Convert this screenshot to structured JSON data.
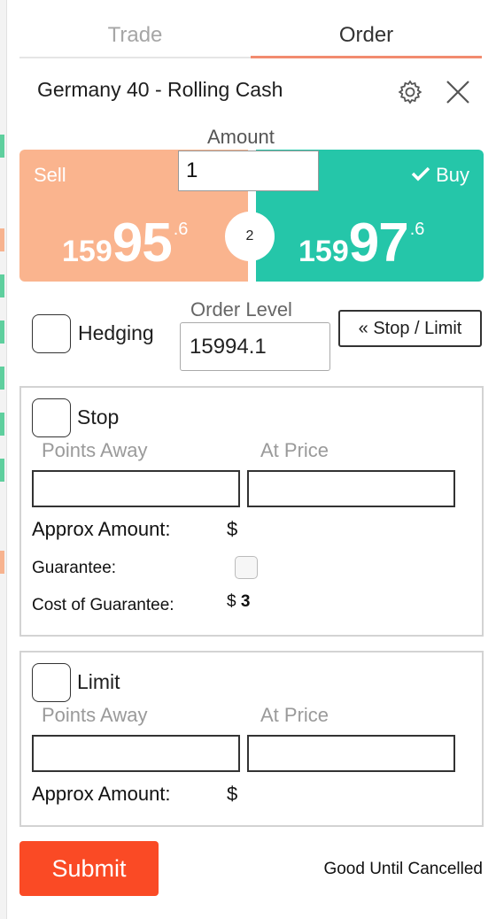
{
  "tabs": [
    {
      "label": "Trade",
      "active": false
    },
    {
      "label": "Order",
      "active": true
    }
  ],
  "instrument_title": "Germany 40 - Rolling Cash",
  "amount": {
    "label": "Amount",
    "value": "1"
  },
  "sell": {
    "label": "Sell",
    "price_prefix": "159",
    "price_main": "95",
    "price_fraction": ".6"
  },
  "buy": {
    "label": "Buy",
    "price_prefix": "159",
    "price_main": "97",
    "price_fraction": ".6"
  },
  "spread": "2",
  "hedging_label": "Hedging",
  "order_level": {
    "label": "Order Level",
    "value": "15994.1"
  },
  "stop_limit_button": "« Stop / Limit",
  "stop_section": {
    "label": "Stop",
    "points_away_placeholder": "Points Away",
    "at_price_placeholder": "At Price",
    "approx_amount_label": "Approx Amount:",
    "approx_amount_value": "$",
    "guarantee_label": "Guarantee:",
    "cost_of_guarantee_label": "Cost of Guarantee:",
    "cost_of_guarantee_currency": "$",
    "cost_of_guarantee_value": "3"
  },
  "limit_section": {
    "label": "Limit",
    "points_away_placeholder": "Points Away",
    "at_price_placeholder": "At Price",
    "approx_amount_label": "Approx Amount:",
    "approx_amount_value": "$"
  },
  "submit_label": "Submit",
  "expiry_label": "Good Until Cancelled",
  "colors": {
    "sell": "#fab48e",
    "buy": "#25c6a9",
    "submit": "#fa4a25",
    "active_tab_underline": "#f28b6f"
  }
}
